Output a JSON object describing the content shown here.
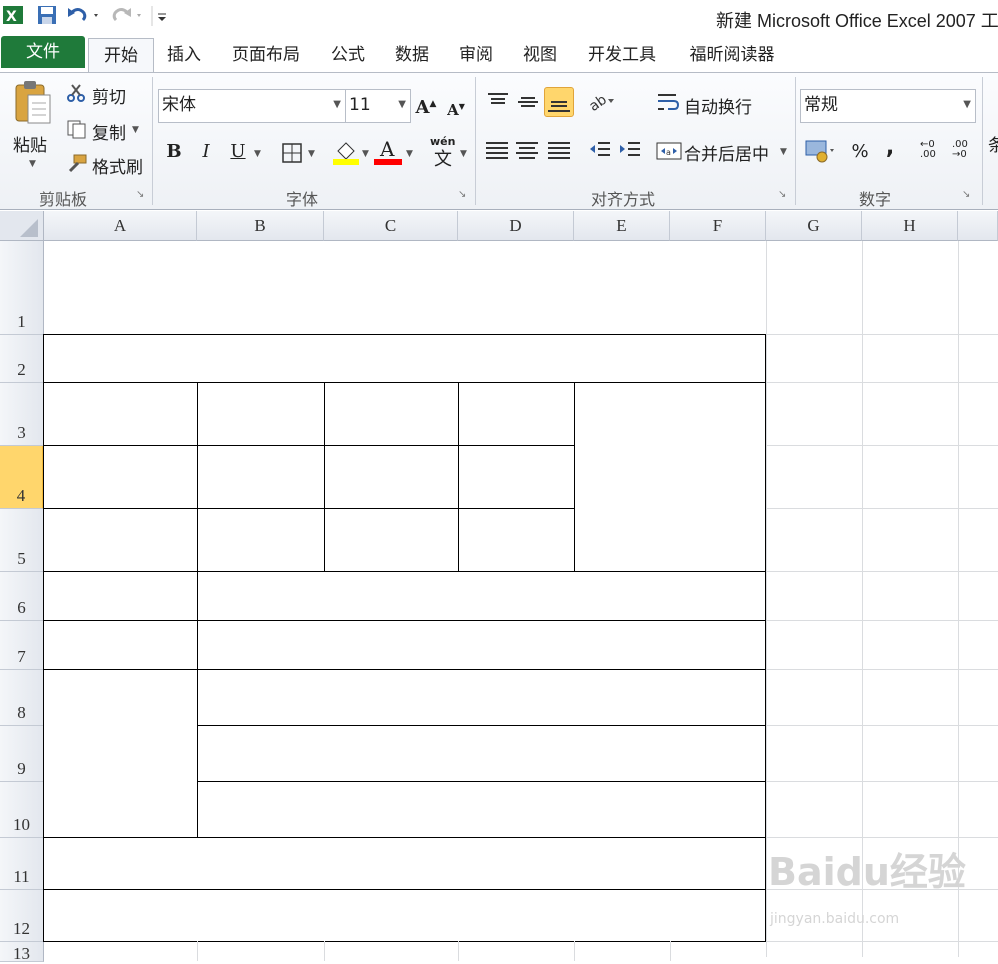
{
  "window": {
    "title": "新建 Microsoft Office Excel 2007 工"
  },
  "tabs": [
    "文件",
    "开始",
    "插入",
    "页面布局",
    "公式",
    "数据",
    "审阅",
    "视图",
    "开发工具",
    "福昕阅读器"
  ],
  "clipboard": {
    "paste": "粘贴",
    "cut": "剪切",
    "copy": "复制",
    "format_painter": "格式刷",
    "group": "剪贴板"
  },
  "font": {
    "name": "宋体",
    "size": "11",
    "bold": "B",
    "italic": "I",
    "underline": "U",
    "color_letter": "A",
    "group": "字体",
    "wen": "wén"
  },
  "alignment": {
    "wrap": "自动换行",
    "merge": "合并后居中",
    "group": "对齐方式"
  },
  "number": {
    "format": "常规",
    "percent": "%",
    "comma": ",",
    "group": "数字",
    "inc": ".00",
    "dec": ".00"
  },
  "partial_label": "条",
  "columns": [
    "A",
    "B",
    "C",
    "D",
    "E",
    "F",
    "G",
    "H"
  ],
  "rows": [
    "1",
    "2",
    "3",
    "4",
    "5",
    "6",
    "7",
    "8",
    "9",
    "10",
    "11",
    "12",
    "13"
  ],
  "selected_row": "4",
  "colors": {
    "file_tab": "#1f7a3a",
    "row_selected": "#ffd66c",
    "highlight_yellow": "#ffff00",
    "font_red": "#ff0000"
  },
  "watermark": {
    "main": "Baidu经验",
    "sub": "jingyan.baidu.com"
  }
}
